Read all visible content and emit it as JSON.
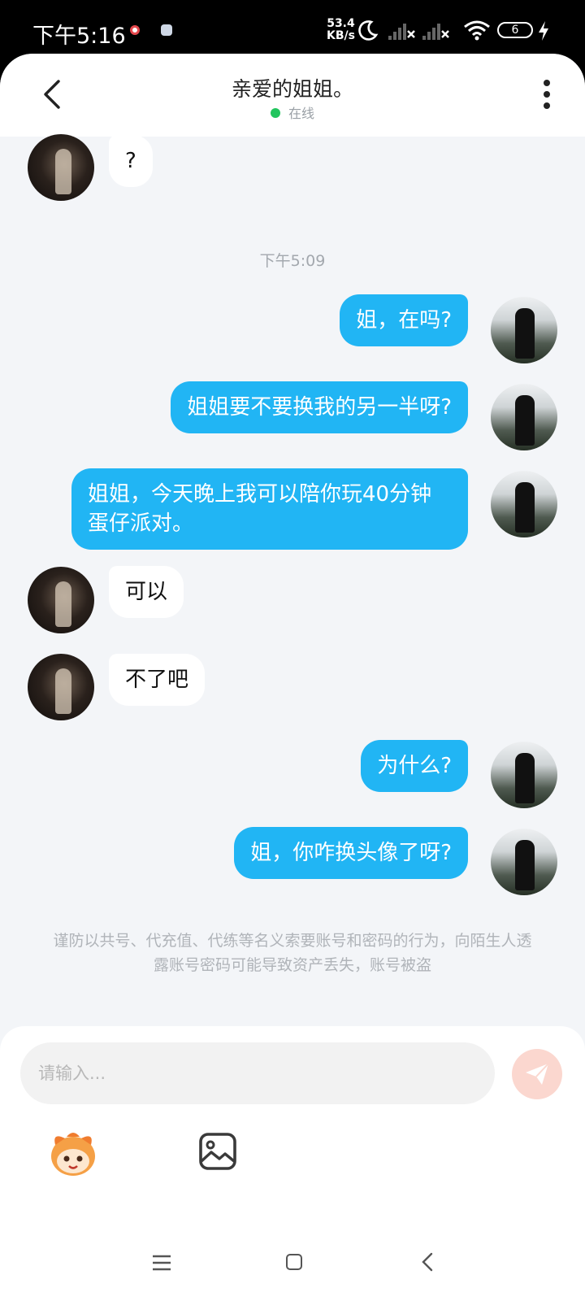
{
  "status_bar": {
    "time": "下午5:16",
    "speed_value": "53.4",
    "speed_unit": "KB/s",
    "battery": "6",
    "icons": [
      "notification-dot-icon",
      "app-notification-icon",
      "moon-icon",
      "signal-icon",
      "signal-icon",
      "wifi-icon",
      "battery-icon",
      "charging-icon"
    ]
  },
  "header": {
    "title": "亲爱的姐姐。",
    "status": "在线",
    "status_color": "#22c55e"
  },
  "messages": {
    "m0": "?",
    "time_separator": "下午5:09",
    "m1": "姐，在吗?",
    "m2": "姐姐要不要换我的另一半呀?",
    "m3": "姐姐，今天晚上我可以陪你玩40分钟蛋仔派对。",
    "m4": "可以",
    "m5": "不了吧",
    "m6": "为什么?",
    "m7": "姐，你咋换头像了呀?"
  },
  "warning": "谨防以共号、代充值、代练等名义索要账号和密码的行为，向陌生人透露账号密码可能导致资产丢失，账号被盗",
  "composer": {
    "placeholder": "请输入..."
  },
  "colors": {
    "my_bubble": "#21b5f4",
    "peer_bubble": "#ffffff",
    "send_button": "#fbd7cf"
  }
}
